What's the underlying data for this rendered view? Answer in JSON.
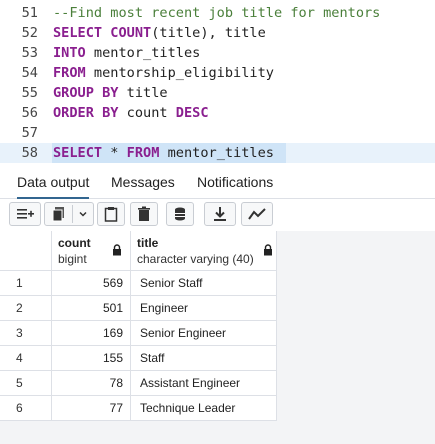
{
  "editor": {
    "lines": [
      {
        "num": "51",
        "tokens": [
          {
            "t": "--Find most recent job title for mentors",
            "c": "cm"
          }
        ]
      },
      {
        "num": "52",
        "tokens": [
          {
            "t": "SELECT ",
            "c": "kw"
          },
          {
            "t": "COUNT",
            "c": "kw"
          },
          {
            "t": "(title), title",
            "c": "id"
          }
        ]
      },
      {
        "num": "53",
        "tokens": [
          {
            "t": "INTO ",
            "c": "kw"
          },
          {
            "t": "mentor_titles",
            "c": "id"
          }
        ]
      },
      {
        "num": "54",
        "tokens": [
          {
            "t": "FROM ",
            "c": "kw"
          },
          {
            "t": "mentorship_eligibility",
            "c": "id"
          }
        ]
      },
      {
        "num": "55",
        "tokens": [
          {
            "t": "GROUP BY ",
            "c": "kw"
          },
          {
            "t": "title",
            "c": "id"
          }
        ]
      },
      {
        "num": "56",
        "tokens": [
          {
            "t": "ORDER BY ",
            "c": "kw"
          },
          {
            "t": "count ",
            "c": "id"
          },
          {
            "t": "DESC",
            "c": "kw"
          }
        ]
      },
      {
        "num": "57",
        "tokens": []
      },
      {
        "num": "58",
        "tokens": [
          {
            "t": "SELECT ",
            "c": "kw"
          },
          {
            "t": "* ",
            "c": "id"
          },
          {
            "t": "FROM ",
            "c": "kw"
          },
          {
            "t": "mentor_titles",
            "c": "id"
          }
        ]
      }
    ]
  },
  "tabs": [
    {
      "label": "Data output",
      "active": true
    },
    {
      "label": "Messages",
      "active": false
    },
    {
      "label": "Notifications",
      "active": false
    }
  ],
  "toolbar": {
    "icons": [
      "add-row-icon",
      "copy-icon",
      "dropdown-chevron-icon",
      "paste-icon",
      "delete-icon",
      "save-data-icon",
      "download-icon",
      "graph-icon"
    ]
  },
  "grid": {
    "columns": [
      {
        "name": "count",
        "type": "bigint"
      },
      {
        "name": "title",
        "type": "character varying (40)"
      }
    ],
    "rows": [
      {
        "n": "1",
        "count": "569",
        "title": "Senior Staff"
      },
      {
        "n": "2",
        "count": "501",
        "title": "Engineer"
      },
      {
        "n": "3",
        "count": "169",
        "title": "Senior Engineer"
      },
      {
        "n": "4",
        "count": "155",
        "title": "Staff"
      },
      {
        "n": "5",
        "count": "78",
        "title": "Assistant Engineer"
      },
      {
        "n": "6",
        "count": "77",
        "title": "Technique Leader"
      }
    ]
  }
}
